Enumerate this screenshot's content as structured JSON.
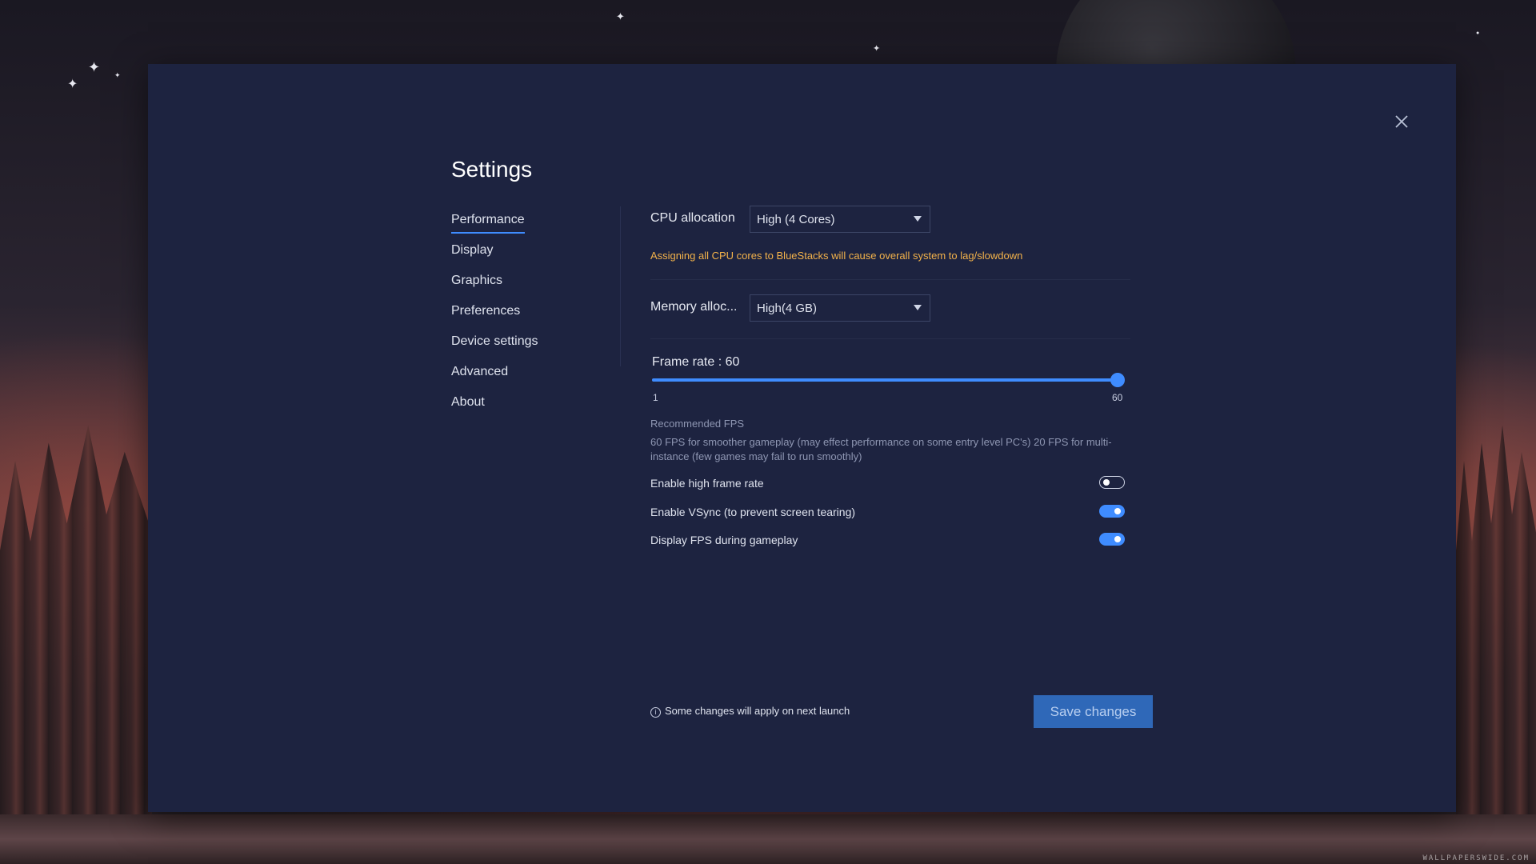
{
  "window": {
    "title": "Settings",
    "close_icon": "close-icon"
  },
  "sidebar": {
    "items": [
      {
        "label": "Performance",
        "active": true
      },
      {
        "label": "Display",
        "active": false
      },
      {
        "label": "Graphics",
        "active": false
      },
      {
        "label": "Preferences",
        "active": false
      },
      {
        "label": "Device settings",
        "active": false
      },
      {
        "label": "Advanced",
        "active": false
      },
      {
        "label": "About",
        "active": false
      }
    ]
  },
  "performance": {
    "cpu": {
      "label": "CPU allocation",
      "value": "High (4 Cores)",
      "warning": "Assigning all CPU cores to BlueStacks will cause overall system to lag/slowdown"
    },
    "memory": {
      "label": "Memory alloc...",
      "value": "High(4 GB)"
    },
    "frame_rate": {
      "label": "Frame rate : 60",
      "value": 60,
      "min": 1,
      "max": 60,
      "min_label": "1",
      "max_label": "60"
    },
    "recommended": {
      "title": "Recommended FPS",
      "text": "60 FPS for smoother gameplay (may effect performance on some entry level PC's) 20 FPS for multi-instance (few games may fail to run smoothly)"
    },
    "toggles": [
      {
        "label": "Enable high frame rate",
        "on": false
      },
      {
        "label": "Enable VSync (to prevent screen tearing)",
        "on": true
      },
      {
        "label": "Display FPS during gameplay",
        "on": true
      }
    ]
  },
  "footer": {
    "note": "Some changes will apply on next launch",
    "info_icon": "info-icon",
    "save_label": "Save changes"
  },
  "background": {
    "watermark": "WALLPAPERSWIDE.COM"
  },
  "colors": {
    "dialog_bg": "#1d2340",
    "accent": "#3f8cff",
    "warning": "#f3b24a",
    "save_button": "#2f68b8"
  }
}
